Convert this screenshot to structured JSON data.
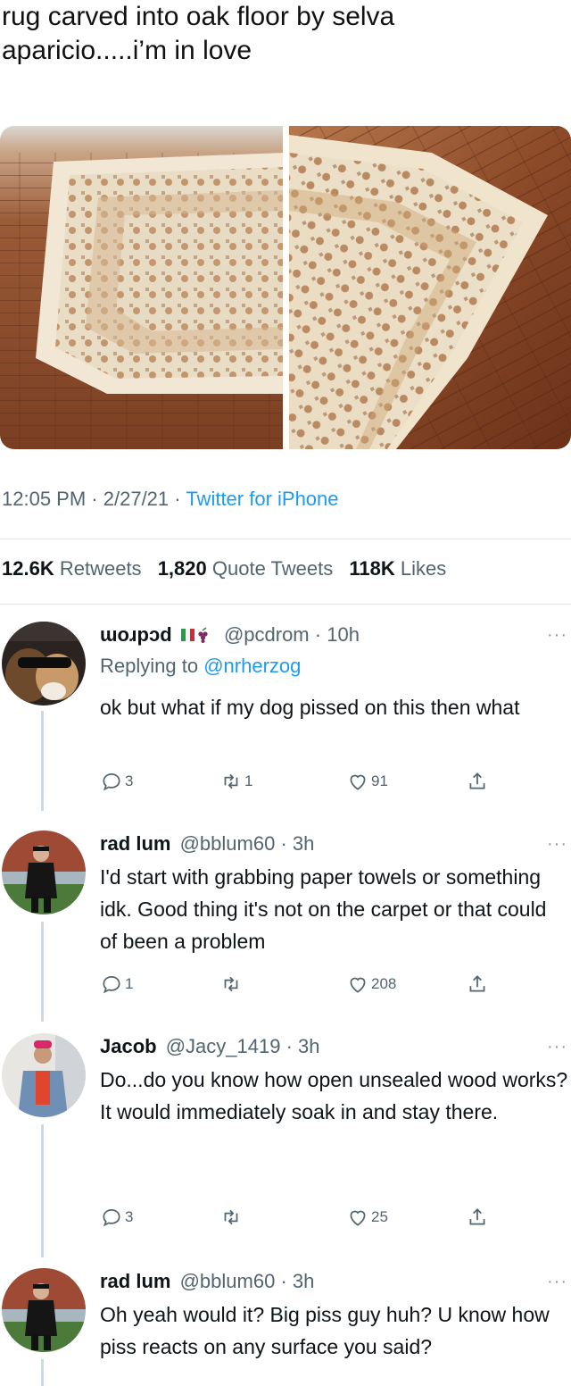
{
  "tweet": {
    "text": "rug carved into oak floor by selva aparicio.....i’m in love",
    "time": "12:05 PM",
    "date": "2/27/21",
    "source": "Twitter for iPhone",
    "sep": "·"
  },
  "stats": {
    "retweets_count": "12.6K",
    "retweets_label": "Retweets",
    "quotes_count": "1,820",
    "quotes_label": "Quote Tweets",
    "likes_count": "118K",
    "likes_label": "Likes"
  },
  "replies": [
    {
      "name": "ɯoɹpɔd",
      "handle": "@pcdrom",
      "time": "10h",
      "replying_label": "Replying to",
      "replying_handle": "@nrherzog",
      "lines": [
        "ok but what if my dog pissed on this then what"
      ],
      "reply_count": "3",
      "retweet_count": "1",
      "like_count": "91"
    },
    {
      "name": "rad lum",
      "handle": "@bblum60",
      "time": "3h",
      "lines": [
        "I'd start with grabbing paper towels or something idk. Good thing it's not on the carpet or that could of been a problem"
      ],
      "reply_count": "1",
      "retweet_count": "",
      "like_count": "208"
    },
    {
      "name": "Jacob",
      "handle": "@Jacy_1419",
      "time": "3h",
      "lines": [
        "Do...do you know how open unsealed wood works?",
        "It would immediately soak in and stay there."
      ],
      "reply_count": "3",
      "retweet_count": "",
      "like_count": "25"
    },
    {
      "name": "rad lum",
      "handle": "@bblum60",
      "time": "3h",
      "lines": [
        "Oh yeah would it? Big piss guy huh? U know how piss reacts on any surface you said?"
      ]
    }
  ],
  "ui": {
    "more": "···"
  },
  "colors": {
    "link": "#1d9bf0",
    "muted": "#536471",
    "text": "#0f1419"
  }
}
